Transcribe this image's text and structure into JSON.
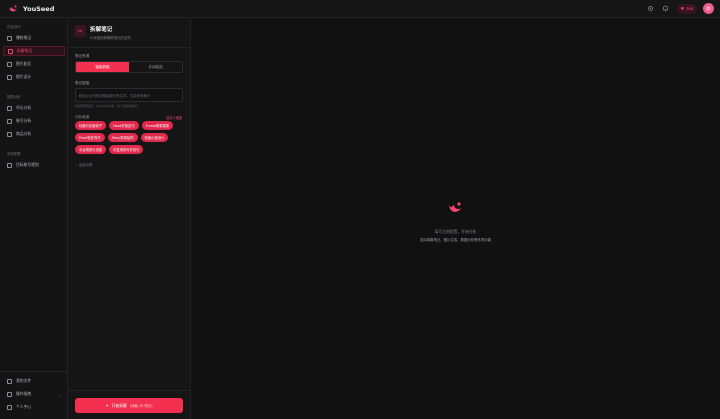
{
  "app": {
    "name": "YouSeed"
  },
  "topbar": {
    "credits": "388",
    "avatar_initial": "即"
  },
  "sidebar": {
    "sections": [
      {
        "label": "内容创作",
        "items": [
          "爆款笔记",
          "拆解笔记",
          "图片配文",
          "图片设计"
        ]
      },
      {
        "label": "数据分析",
        "items": [
          "评论分析",
          "账号分析",
          "商品分析"
        ]
      },
      {
        "label": "系统配置",
        "items": [
          "目标账号规划"
        ]
      }
    ],
    "bottom": [
      "我的文件",
      "操作指南",
      "个人中心"
    ],
    "active": "拆解笔记"
  },
  "panel": {
    "title": "拆解笔记",
    "subtitle": "AI深度拆解爆款笔记的结构",
    "source_label": "笔记来源",
    "source_options": [
      "链接抓取",
      "手动粘贴"
    ],
    "source_selected": "链接抓取",
    "link_label": "笔记链接",
    "link_placeholder": "粘贴小红书笔记链接或分享文本，支持多条换行",
    "hint": "支持网页链接、App分享文本，多个链接请换行",
    "dimensions_label": "分析维度",
    "custom_link": "自定义维度",
    "tags": [
      "标题与封面钩子",
      "Hook开篇技巧",
      "Frame叙事框架",
      "Proof信任背书",
      "Story叙事结构",
      "情绪价值设计",
      "平台规则与流量",
      "可复用的写作技巧"
    ],
    "advanced": "高级设置",
    "start_button": "开始拆解",
    "start_cost": "(消耗 20 积分)"
  },
  "main": {
    "empty_title": "填写左侧配置，开始分析",
    "empty_sub": "支持单篇笔记、图片生成、数据分析等多项功能"
  },
  "colors": {
    "accent": "#f3304f",
    "accent_text": "#f3456e",
    "background": "#111112"
  }
}
